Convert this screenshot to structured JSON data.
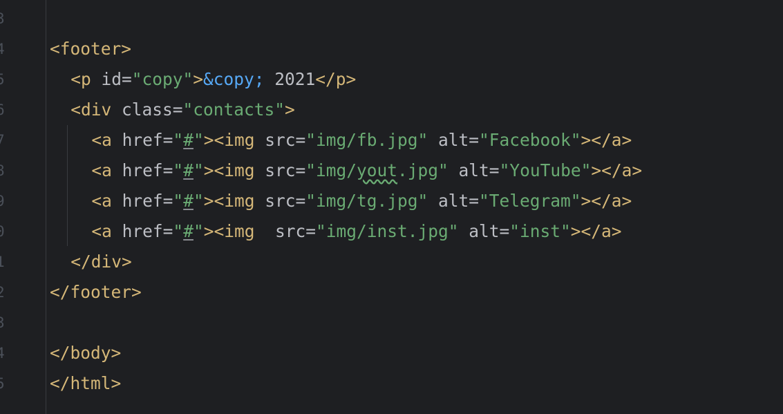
{
  "editor": {
    "line_numbers": [
      "3",
      "4",
      "5",
      "6",
      "7",
      "8",
      "9",
      "0",
      "1",
      "2",
      "3",
      "4",
      "5"
    ],
    "lines": [
      {
        "t": []
      },
      {
        "t": [
          [
            "tag",
            "<footer>"
          ]
        ]
      },
      {
        "t": [
          [
            "tag",
            "<p "
          ],
          [
            "attr",
            "id="
          ],
          [
            "str",
            "\"copy\""
          ],
          [
            "tag",
            ">"
          ],
          [
            "ent",
            "&copy;"
          ],
          [
            "txt",
            " 2021"
          ],
          [
            "tag",
            "</p>"
          ]
        ]
      },
      {
        "t": [
          [
            "tag",
            "<div "
          ],
          [
            "attr",
            "class="
          ],
          [
            "str",
            "\"contacts\""
          ],
          [
            "tag",
            ">"
          ]
        ]
      },
      {
        "t": [
          [
            "tag",
            "<a "
          ],
          [
            "attr",
            "href="
          ],
          [
            "str",
            "\""
          ],
          [
            "str lnk",
            "#"
          ],
          [
            "str",
            "\""
          ],
          [
            "tag",
            "><img "
          ],
          [
            "attr",
            "src="
          ],
          [
            "str",
            "\"img/fb.jpg\""
          ],
          [
            "attr",
            " alt="
          ],
          [
            "str",
            "\"Facebook\""
          ],
          [
            "tag",
            "></a>"
          ]
        ]
      },
      {
        "t": [
          [
            "tag",
            "<a "
          ],
          [
            "attr",
            "href="
          ],
          [
            "str",
            "\""
          ],
          [
            "str lnk",
            "#"
          ],
          [
            "str",
            "\""
          ],
          [
            "tag",
            "><img "
          ],
          [
            "attr",
            "src="
          ],
          [
            "str",
            "\"img/"
          ],
          [
            "str typo",
            "yout"
          ],
          [
            "str",
            ".jpg\""
          ],
          [
            "attr",
            " alt="
          ],
          [
            "str",
            "\"YouTube\""
          ],
          [
            "tag",
            "></a>"
          ]
        ]
      },
      {
        "t": [
          [
            "tag",
            "<a "
          ],
          [
            "attr",
            "href="
          ],
          [
            "str",
            "\""
          ],
          [
            "str lnk",
            "#"
          ],
          [
            "str",
            "\""
          ],
          [
            "tag",
            "><img "
          ],
          [
            "attr",
            "src="
          ],
          [
            "str",
            "\"img/tg.jpg\""
          ],
          [
            "attr",
            " alt="
          ],
          [
            "str",
            "\"Telegram\""
          ],
          [
            "tag",
            "></a>"
          ]
        ]
      },
      {
        "t": [
          [
            "tag",
            "<a "
          ],
          [
            "attr",
            "href="
          ],
          [
            "str",
            "\""
          ],
          [
            "str lnk",
            "#"
          ],
          [
            "str",
            "\""
          ],
          [
            "tag",
            "><img  "
          ],
          [
            "attr",
            "src="
          ],
          [
            "str",
            "\"img/inst.jpg\""
          ],
          [
            "attr",
            " alt="
          ],
          [
            "str",
            "\"inst\""
          ],
          [
            "tag",
            "></a>"
          ]
        ]
      },
      {
        "t": [
          [
            "tag",
            "</div>"
          ]
        ]
      },
      {
        "t": [
          [
            "tag",
            "</footer>"
          ]
        ]
      },
      {
        "t": []
      },
      {
        "t": [
          [
            "tag",
            "</body>"
          ]
        ]
      },
      {
        "t": [
          [
            "tag",
            "</html>"
          ]
        ]
      }
    ]
  },
  "colors": {
    "background": "#1e1f22",
    "tag": "#d5b778",
    "attribute": "#bcbec4",
    "string": "#6aab73",
    "entity": "#56a8f5",
    "line_number": "#4b5059"
  }
}
